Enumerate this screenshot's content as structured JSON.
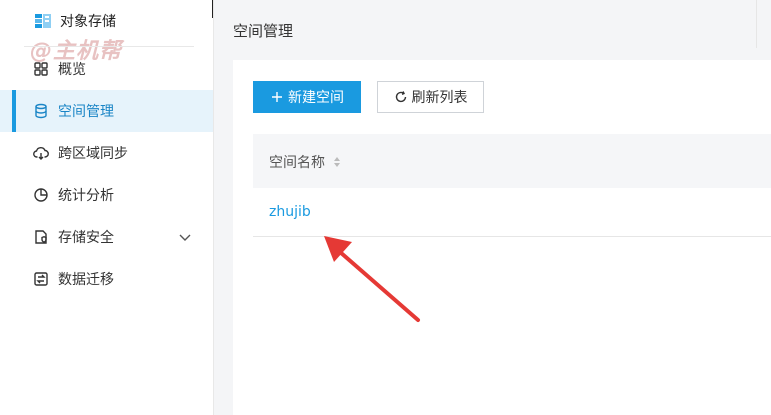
{
  "sidebar": {
    "brand": "对象存储",
    "watermark": "@主机帮",
    "items": [
      {
        "label": "概览",
        "icon": "grid-icon"
      },
      {
        "label": "空间管理",
        "icon": "database-icon",
        "active": true
      },
      {
        "label": "跨区域同步",
        "icon": "cloud-sync-icon"
      },
      {
        "label": "统计分析",
        "icon": "pie-chart-icon"
      },
      {
        "label": "存储安全",
        "icon": "shield-file-icon",
        "expandable": true
      },
      {
        "label": "数据迁移",
        "icon": "migrate-icon"
      }
    ]
  },
  "header": {
    "title": "空间管理"
  },
  "toolbar": {
    "create_label": "新建空间",
    "refresh_label": "刷新列表"
  },
  "table": {
    "columns": [
      "空间名称"
    ],
    "rows": [
      {
        "name": "zhujib"
      }
    ]
  },
  "colors": {
    "accent": "#1a9ae0",
    "active_bg": "#e6f3fb",
    "annotation": "#e53935"
  }
}
